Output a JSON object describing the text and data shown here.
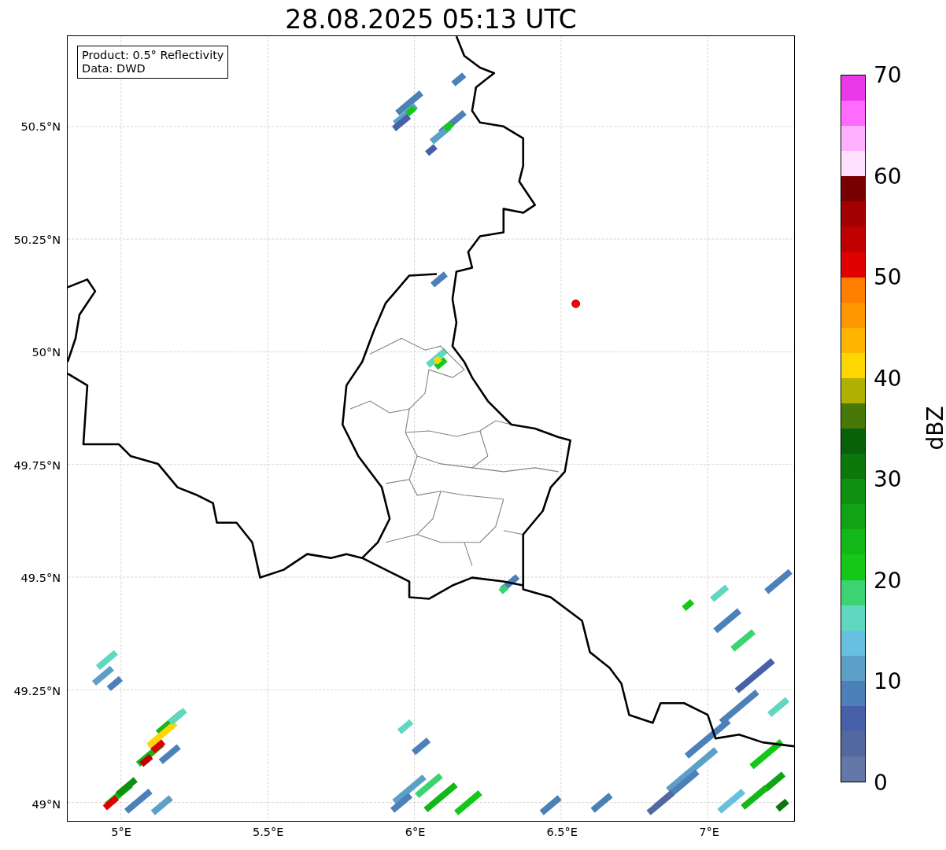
{
  "title": "28.08.2025 05:13 UTC",
  "legend": {
    "lines": [
      "Product: 0.5° Reflectivity",
      "Data: DWD"
    ]
  },
  "x_axis": {
    "ticks": [
      "5°E",
      "5.5°E",
      "6°E",
      "6.5°E",
      "7°E"
    ]
  },
  "y_axis": {
    "ticks": [
      "50.5°N",
      "50.25°N",
      "50°N",
      "49.75°N",
      "49.5°N",
      "49.25°N",
      "49°N"
    ]
  },
  "colorbar": {
    "label": "dBZ",
    "ticks": [
      "70",
      "60",
      "50",
      "40",
      "30",
      "20",
      "10",
      "0"
    ],
    "bands": [
      {
        "color": "#e838e8"
      },
      {
        "color": "#ff6aff"
      },
      {
        "color": "#ffb0ff"
      },
      {
        "color": "#ffe0ff"
      },
      {
        "color": "#780000"
      },
      {
        "color": "#a00000"
      },
      {
        "color": "#c00000"
      },
      {
        "color": "#e00000"
      },
      {
        "color": "#ff8000"
      },
      {
        "color": "#ff9800"
      },
      {
        "color": "#ffb400"
      },
      {
        "color": "#ffd700"
      },
      {
        "color": "#b0b000"
      },
      {
        "color": "#487808"
      },
      {
        "color": "#086008"
      },
      {
        "color": "#0c780c"
      },
      {
        "color": "#0e9010"
      },
      {
        "color": "#10a414"
      },
      {
        "color": "#12b818"
      },
      {
        "color": "#14c818"
      },
      {
        "color": "#3cd470"
      },
      {
        "color": "#60d8c0"
      },
      {
        "color": "#68c0e0"
      },
      {
        "color": "#5ca0c8"
      },
      {
        "color": "#4c80b8"
      },
      {
        "color": "#4860a8"
      },
      {
        "color": "#5468a0"
      },
      {
        "color": "#6478a8"
      }
    ]
  }
}
